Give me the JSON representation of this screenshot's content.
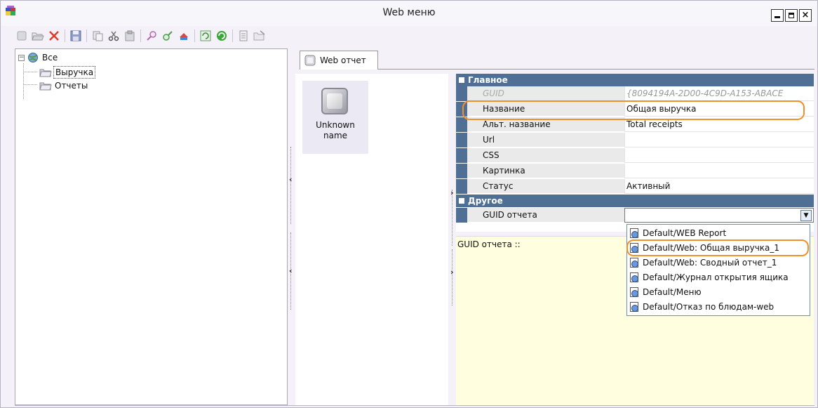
{
  "window": {
    "title": "Web меню"
  },
  "tree": {
    "root": "Все",
    "items": [
      "Выручка",
      "Отчеты"
    ]
  },
  "tab": {
    "label": "Web отчет"
  },
  "tile": {
    "label_line1": "Unknown",
    "label_line2": "name"
  },
  "propgrid": {
    "categories": {
      "main": "Главное",
      "other": "Другое"
    },
    "rows": [
      {
        "name": "GUID",
        "value": "{8094194A-2D00-4C9D-A153-ABACE"
      },
      {
        "name": "Название",
        "value": "Общая выручка"
      },
      {
        "name": "Альт. название",
        "value": "Total receipts"
      },
      {
        "name": "Url",
        "value": ""
      },
      {
        "name": "CSS",
        "value": ""
      },
      {
        "name": "Картинка",
        "value": ""
      },
      {
        "name": "Статус",
        "value": "Активный"
      }
    ],
    "other_rows": [
      {
        "name": "GUID отчета",
        "value": ""
      }
    ]
  },
  "description": {
    "text": "GUID отчета ::"
  },
  "dropdown": {
    "options": [
      "Default/WEB Report",
      "Default/Web: Общая выручка_1",
      "Default/Web: Сводный отчет_1",
      "Default/Журнал открытия ящика",
      "Default/Меню",
      "Default/Отказ по блюдам-web"
    ]
  },
  "colors": {
    "category_header": "#4f6f95",
    "highlight": "#f0902a",
    "description_bg": "#ffffe0"
  },
  "toolbar_icons": [
    "new-icon",
    "open-icon",
    "delete-icon",
    "save-icon",
    "copy-icon",
    "cut-icon",
    "paste-icon",
    "find-icon",
    "replace-icon",
    "export-icon",
    "refresh-icon",
    "sync-icon",
    "properties-icon",
    "import-icon"
  ]
}
